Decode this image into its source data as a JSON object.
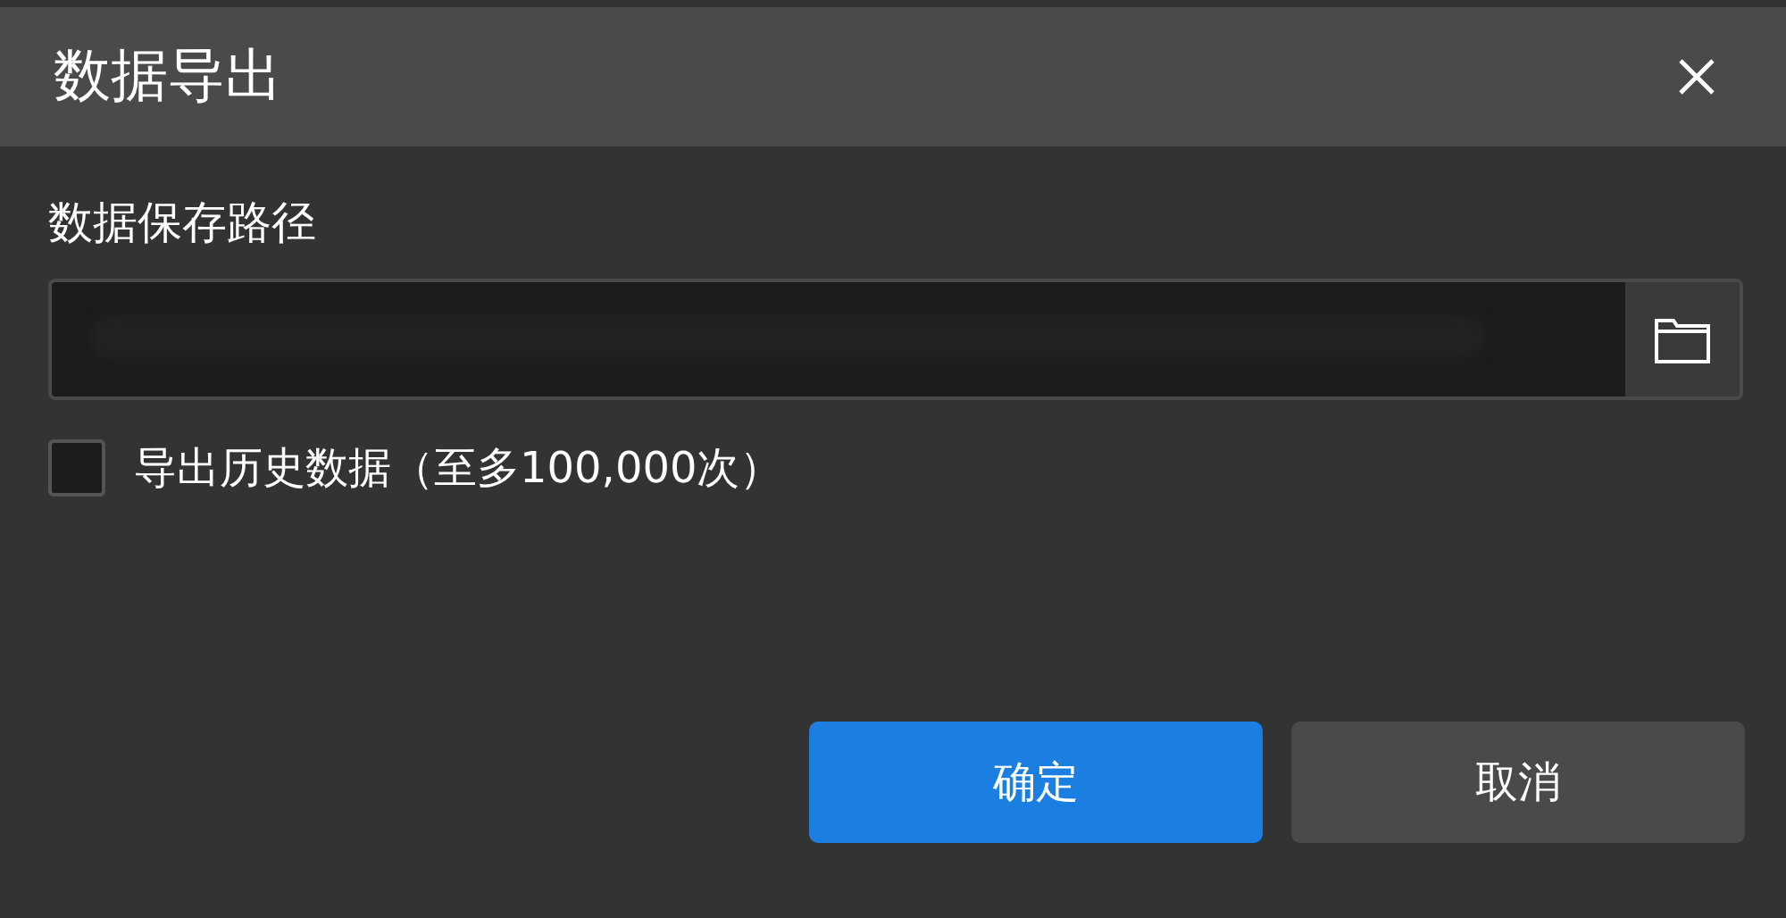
{
  "window": {
    "title": "数据导出"
  },
  "path": {
    "label": "数据保存路径"
  },
  "history_option": {
    "label": "导出历史数据（至多100,000次）",
    "checked": false
  },
  "buttons": [
    {
      "label": "确定",
      "kind": "primary"
    },
    {
      "label": "取消",
      "kind": "secondary"
    }
  ]
}
